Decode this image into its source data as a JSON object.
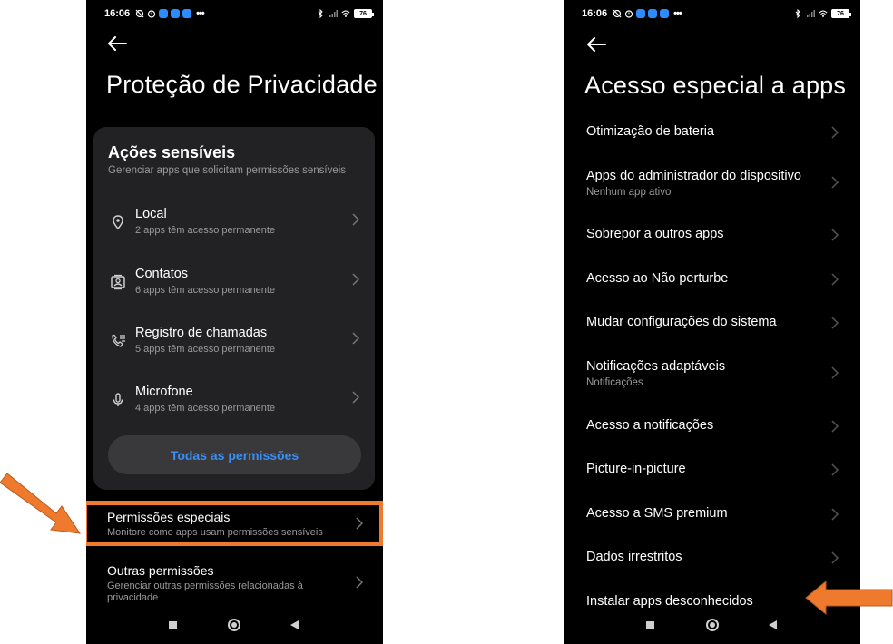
{
  "colors": {
    "accent_blue": "#3a8ff5",
    "highlight_orange": "#ef7a2e",
    "card_bg": "#222224",
    "subtext": "#9a9a9c"
  },
  "left_screen": {
    "status": {
      "time": "16:06",
      "battery": "76"
    },
    "title": "Proteção de Privacidade",
    "card": {
      "title": "Ações sensíveis",
      "subtitle": "Gerenciar apps que solicitam permissões sensíveis",
      "items": [
        {
          "icon": "location-pin-icon",
          "label": "Local",
          "sub": "2 apps têm acesso permanente"
        },
        {
          "icon": "contacts-icon",
          "label": "Contatos",
          "sub": "6 apps têm acesso permanente"
        },
        {
          "icon": "call-log-icon",
          "label": "Registro de chamadas",
          "sub": "5 apps têm acesso permanente"
        },
        {
          "icon": "microphone-icon",
          "label": "Microfone",
          "sub": "4 apps têm acesso permanente"
        }
      ],
      "all_button": "Todas as permissões"
    },
    "special": {
      "label": "Permissões especiais",
      "sub": "Monitore como apps usam permissões sensíveis"
    },
    "others": {
      "label": "Outras permissões",
      "sub_line1": "Gerenciar outras permissões relacionadas à",
      "sub_line2": "privacidade"
    }
  },
  "right_screen": {
    "status": {
      "time": "16:06",
      "battery": "76"
    },
    "title": "Acesso especial a apps",
    "items": [
      {
        "label": "Otimização de bateria",
        "sub": ""
      },
      {
        "label": "Apps do administrador do dispositivo",
        "sub": "Nenhum app ativo"
      },
      {
        "label": "Sobrepor a outros apps",
        "sub": ""
      },
      {
        "label": "Acesso ao Não perturbe",
        "sub": ""
      },
      {
        "label": "Mudar configurações do sistema",
        "sub": ""
      },
      {
        "label": "Notificações adaptáveis",
        "sub": "Notificações"
      },
      {
        "label": "Acesso a notificações",
        "sub": ""
      },
      {
        "label": "Picture-in-picture",
        "sub": ""
      },
      {
        "label": "Acesso a SMS premium",
        "sub": ""
      },
      {
        "label": "Dados irrestritos",
        "sub": ""
      },
      {
        "label": "Instalar apps desconhecidos",
        "sub": ""
      }
    ]
  }
}
